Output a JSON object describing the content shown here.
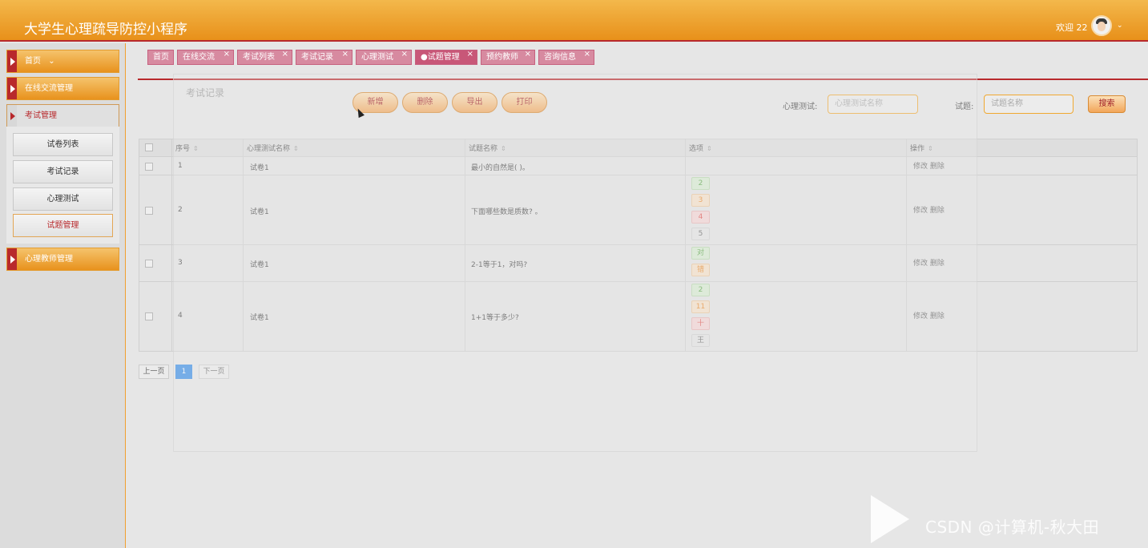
{
  "header": {
    "title": "大学生心理疏导防控小程序",
    "welcome": "欢迎 22",
    "avatar_icon": "user-avatar-icon",
    "chevron_icon": "chevron-down-icon"
  },
  "sidebar": {
    "items": [
      {
        "label": "首页",
        "suffix": "⌄"
      },
      {
        "label": "在线交流管理"
      },
      {
        "label": "考试管理"
      },
      {
        "label": "心理教师管理"
      }
    ],
    "subitems": [
      "试卷列表",
      "考试记录",
      "心理测试",
      "试题管理"
    ]
  },
  "tabs": [
    "首页",
    "在线交流",
    "考试列表",
    "考试记录",
    "心理测试",
    "●试题管理",
    "预约教师",
    "咨询信息"
  ],
  "toolbar": {
    "add": "新增",
    "delete": "删除",
    "export": "导出",
    "print": "打印"
  },
  "search": {
    "test_label": "心理测试:",
    "test_placeholder": "心理测试名称",
    "question_label": "试题:",
    "question_placeholder": "试题名称",
    "button": "搜索"
  },
  "table": {
    "headers": [
      "序号",
      "心理测试名称",
      "试题名称",
      "选项",
      "操作"
    ],
    "rows": [
      {
        "no": "1",
        "test": "试卷1",
        "question": "最小的自然是( )。",
        "options": []
      },
      {
        "no": "2",
        "test": "试卷1",
        "question": "下面哪些数是质数? 。",
        "options": [
          "2",
          "3",
          "4",
          "5"
        ]
      },
      {
        "no": "3",
        "test": "试卷1",
        "question": "2-1等于1，对吗?",
        "options": [
          "对",
          "错"
        ]
      },
      {
        "no": "4",
        "test": "试卷1",
        "question": "1+1等于多少?",
        "options": [
          "2",
          "11",
          "十",
          "王"
        ]
      }
    ],
    "actions": {
      "edit": "修改",
      "delete": "删除"
    }
  },
  "pagination": {
    "prev": "上一页",
    "current": "1",
    "next": "下一页"
  },
  "overlay": {
    "ghost_title": "考试记录"
  },
  "watermark": "CSDN @计算机-秋大田"
}
